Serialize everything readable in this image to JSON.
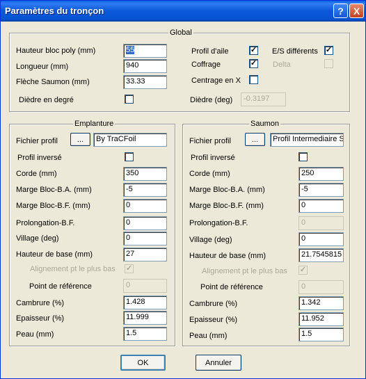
{
  "window": {
    "title": "Paramètres du tronçon",
    "help": "?",
    "close": "X"
  },
  "global": {
    "legend": "Global",
    "hauteur_bloc": {
      "label": "Hauteur bloc poly (mm)",
      "value": "55"
    },
    "longueur": {
      "label": "Longueur (mm)",
      "value": "940"
    },
    "fleche": {
      "label": "Flèche Saumon (mm)",
      "value": "33.33"
    },
    "diedre_degre": {
      "label": "Dièdre en degré",
      "checked": false
    },
    "profil_aile": {
      "label": "Profil d'aile",
      "checked": true
    },
    "coffrage": {
      "label": "Coffrage",
      "checked": true
    },
    "centrage": {
      "label": "Centrage en X",
      "checked": false
    },
    "es_diff": {
      "label": "E/S différents",
      "checked": true
    },
    "delta": {
      "label": "Delta",
      "checked": false
    },
    "diedre_deg": {
      "label": "Dièdre (deg)",
      "value": "-0.3197"
    }
  },
  "emplanture": {
    "legend": "Emplanture",
    "fichier": {
      "label": "Fichier profil",
      "button": "...",
      "value": "By TraCFoil"
    },
    "profil_inverse": {
      "label": "Profil inversé",
      "checked": false
    },
    "corde": {
      "label": "Corde  (mm)",
      "value": "350"
    },
    "marge_ba": {
      "label": "Marge Bloc-B.A. (mm)",
      "value": "-5"
    },
    "marge_bf": {
      "label": "Marge Bloc-B.F. (mm)",
      "value": "0"
    },
    "prolongation": {
      "label": "Prolongation-B.F.",
      "value": "0"
    },
    "village": {
      "label": "Village (deg)",
      "value": "0"
    },
    "hauteur_base": {
      "label": "Hauteur de base (mm)",
      "value": "27"
    },
    "alignement": {
      "label": "Alignement pt le plus bas",
      "checked": true
    },
    "point_ref": {
      "label": "Point de référence",
      "value": "0"
    },
    "cambrure": {
      "label": "Cambrure (%)",
      "value": "1.428"
    },
    "epaisseur": {
      "label": "Epaisseur (%)",
      "value": "11.999"
    },
    "peau": {
      "label": "Peau (mm)",
      "value": "1.5"
    }
  },
  "saumon": {
    "legend": "Saumon",
    "fichier": {
      "label": "Fichier profil",
      "button": "...",
      "value": "Profil Intermediaire SE"
    },
    "profil_inverse": {
      "label": "Profil inversé",
      "checked": false
    },
    "corde": {
      "label": "Corde (mm)",
      "value": "250"
    },
    "marge_ba": {
      "label": "Marge Bloc-B.A. (mm)",
      "value": "-5"
    },
    "marge_bf": {
      "label": "Marge Bloc-B.F. (mm)",
      "value": "0"
    },
    "prolongation": {
      "label": "Prolongation-B.F.",
      "value": "0"
    },
    "village": {
      "label": "Village (deg)",
      "value": "0"
    },
    "hauteur_base": {
      "label": "Hauteur de base (mm)",
      "value": "21.7545815"
    },
    "alignement": {
      "label": "Alignement pt le plus bas",
      "checked": true
    },
    "point_ref": {
      "label": "Point de référence",
      "value": "0"
    },
    "cambrure": {
      "label": "Cambrure (%)",
      "value": "1.342"
    },
    "epaisseur": {
      "label": "Epaisseur (%)",
      "value": "11.952"
    },
    "peau": {
      "label": "Peau (mm)",
      "value": "1.5"
    }
  },
  "buttons": {
    "ok": "OK",
    "cancel": "Annuler"
  }
}
